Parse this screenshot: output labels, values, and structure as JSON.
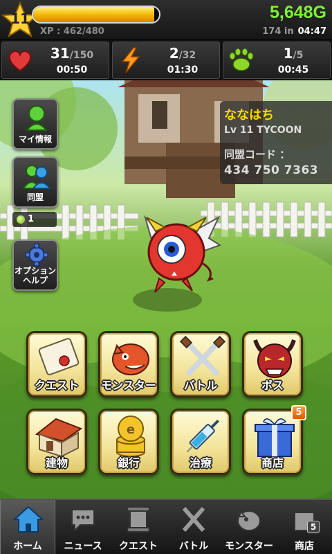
{
  "player": {
    "level": "11",
    "xp_text": "XP : 462/480",
    "xp_progress": 0.9625,
    "gold": "5,648G",
    "timer_prefix": "174 in",
    "timer_value": "04:47"
  },
  "stats": [
    {
      "icon": "heart-icon",
      "current": "31",
      "max": "/150",
      "time": "00:50"
    },
    {
      "icon": "lightning-icon",
      "current": "2",
      "max": "/32",
      "time": "01:30"
    },
    {
      "icon": "paw-icon",
      "current": "1",
      "max": "/5",
      "time": "00:45"
    }
  ],
  "side": {
    "my_info": "マイ情報",
    "alliance": "同盟",
    "ally_count": "1",
    "options_line1": "オプション",
    "options_line2": "ヘルプ"
  },
  "profile": {
    "name": "ななはち",
    "level_title": "Lv 11 TYCOON",
    "code_label": "同盟コード ：",
    "code": "434 750 7363"
  },
  "menu": {
    "quest": "クエスト",
    "monster": "モンスター",
    "battle": "バトル",
    "boss": "ボス",
    "building": "建物",
    "bank": "銀行",
    "heal": "治療",
    "shop": "商店",
    "shop_badge": "5"
  },
  "nav": {
    "home": "ホーム",
    "news": "ニュース",
    "quest": "クエスト",
    "battle": "バトル",
    "monster": "モンスター",
    "shop": "商店",
    "shop_badge": "5"
  },
  "colors": {
    "gold_text": "#7cf23a",
    "xp_fill": "#f2b400",
    "name_text": "#ffd800",
    "badge": "#e05a00"
  }
}
